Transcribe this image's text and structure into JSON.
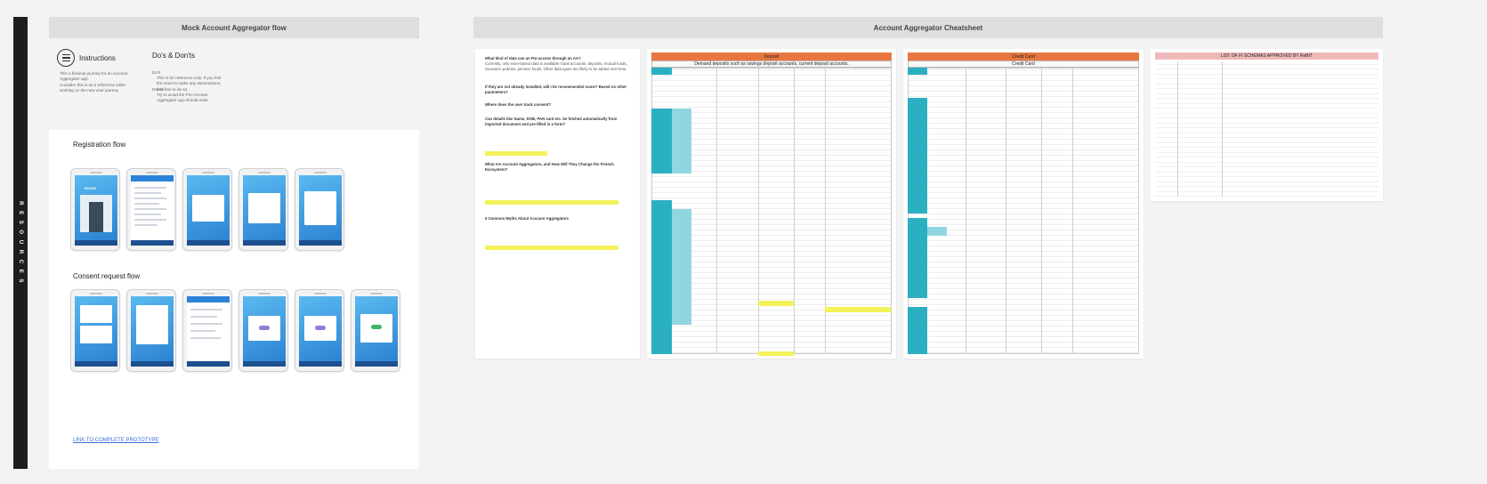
{
  "sidebar": {
    "label": "R E S O U R C E S"
  },
  "mock_flow": {
    "header": "Mock Account Aggregator flow",
    "instructions": {
      "title": "Instructions",
      "bullets": [
        "This a fictional journey for an Account Aggregator app.",
        "Consider this is as a reference while working on the new user journey"
      ]
    },
    "dos_donts": {
      "title": "Do's & Don'ts",
      "do_label": "Do's",
      "do_text": "This is for reference only. If you feel the need to make any assumptions, feel free to do so.",
      "dont_label": "Don'ts",
      "dont_text": "Try to avoid the Fin-Account Aggregator app should exist."
    },
    "registration_title": "Registration flow",
    "consent_title": "Consent request flow",
    "brand": "EKATA",
    "prototype_link": "LINK TO COMPLETE PROTOTYPE"
  },
  "cheatsheet": {
    "header": "Account Aggregator Cheatsheet",
    "faq": [
      "What kind of data can an FIU access through an AA?",
      "Currently, only even-based data is available: bank accounts, deposits, mutual funds, insurance policies, pension funds. Other data types are likely to be added over time.",
      "If they are not already installed, will I be recommended some? Based on other parameters?",
      "Where does the user track consent?",
      "Can details like Name, DOB, PAN card etc. be fetched automatically from imported document and pre-filled in a form?",
      "What Are Account Aggregators, and How Will They Change the Fintech Ecosystem?",
      "5 Common Myths About Account Aggregators"
    ],
    "deposit": {
      "title": "Deposit",
      "subtitle": "Demand deposits such as savings deposit accounts, current deposit accounts."
    },
    "credit_card": {
      "title": "Credit Card",
      "subtitle": "Credit Card"
    },
    "fi_schemas": {
      "title": "LIST OF FI SCHEMAS APPROVED BY ReBIT"
    }
  },
  "colors": {
    "accent_orange": "#e8773f",
    "accent_teal": "#2bb0c2",
    "highlight": "#f4f25a",
    "link": "#3b6fd6",
    "sidebar": "#1e1e1e"
  }
}
